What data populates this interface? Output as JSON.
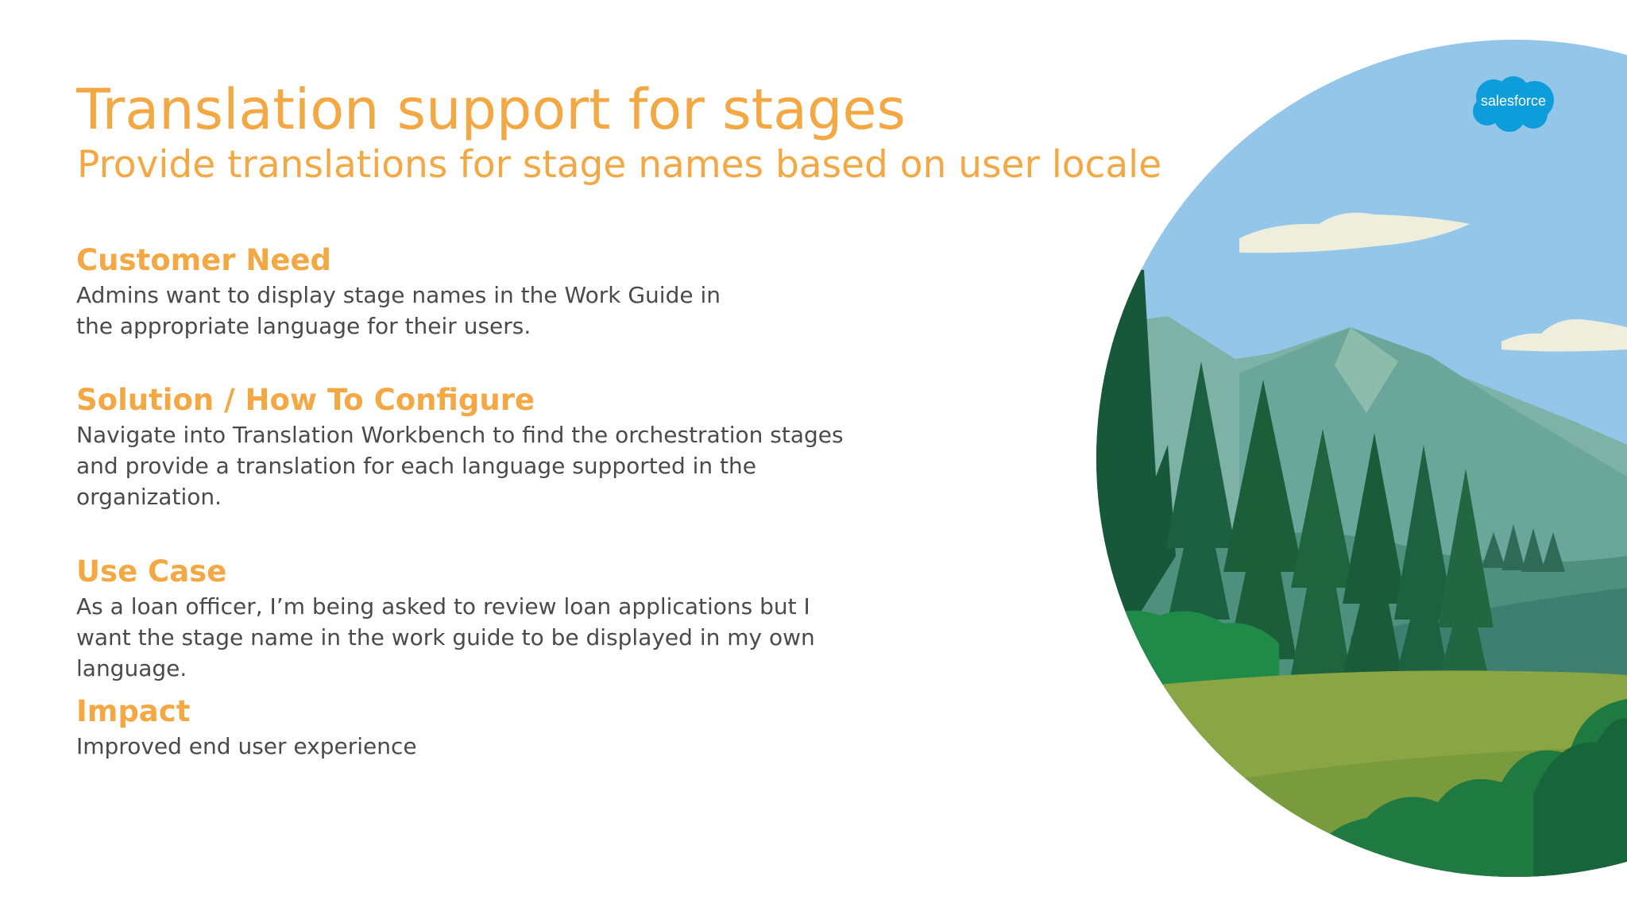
{
  "slide": {
    "title": "Translation support for stages",
    "subtitle": "Provide translations for stage names based on user locale",
    "sections": [
      {
        "heading": "Customer Need",
        "body": "Admins want to display stage names in the Work Guide in the appropriate language for their users."
      },
      {
        "heading": "Solution / How To Configure",
        "body": "Navigate into Translation Workbench to find the orchestration stages and provide a translation for each language supported in the organization."
      },
      {
        "heading": "Use Case",
        "body": "As a loan officer, I’m being asked to review loan applications but I want the stage name in the work guide to be displayed in my own language."
      },
      {
        "heading": "Impact",
        "body": "Improved end user experience"
      }
    ]
  },
  "logo": {
    "text": "salesforce",
    "icon": "salesforce-cloud-logo",
    "color": "#0d9dda"
  },
  "illustration": {
    "icon": "mountain-forest-landscape",
    "colors": {
      "sky": "#94c6ea",
      "mountain": "#6aa79a",
      "forest": "#1d5e3a",
      "meadow": "#8aa544",
      "accent": "#f4a844"
    }
  }
}
